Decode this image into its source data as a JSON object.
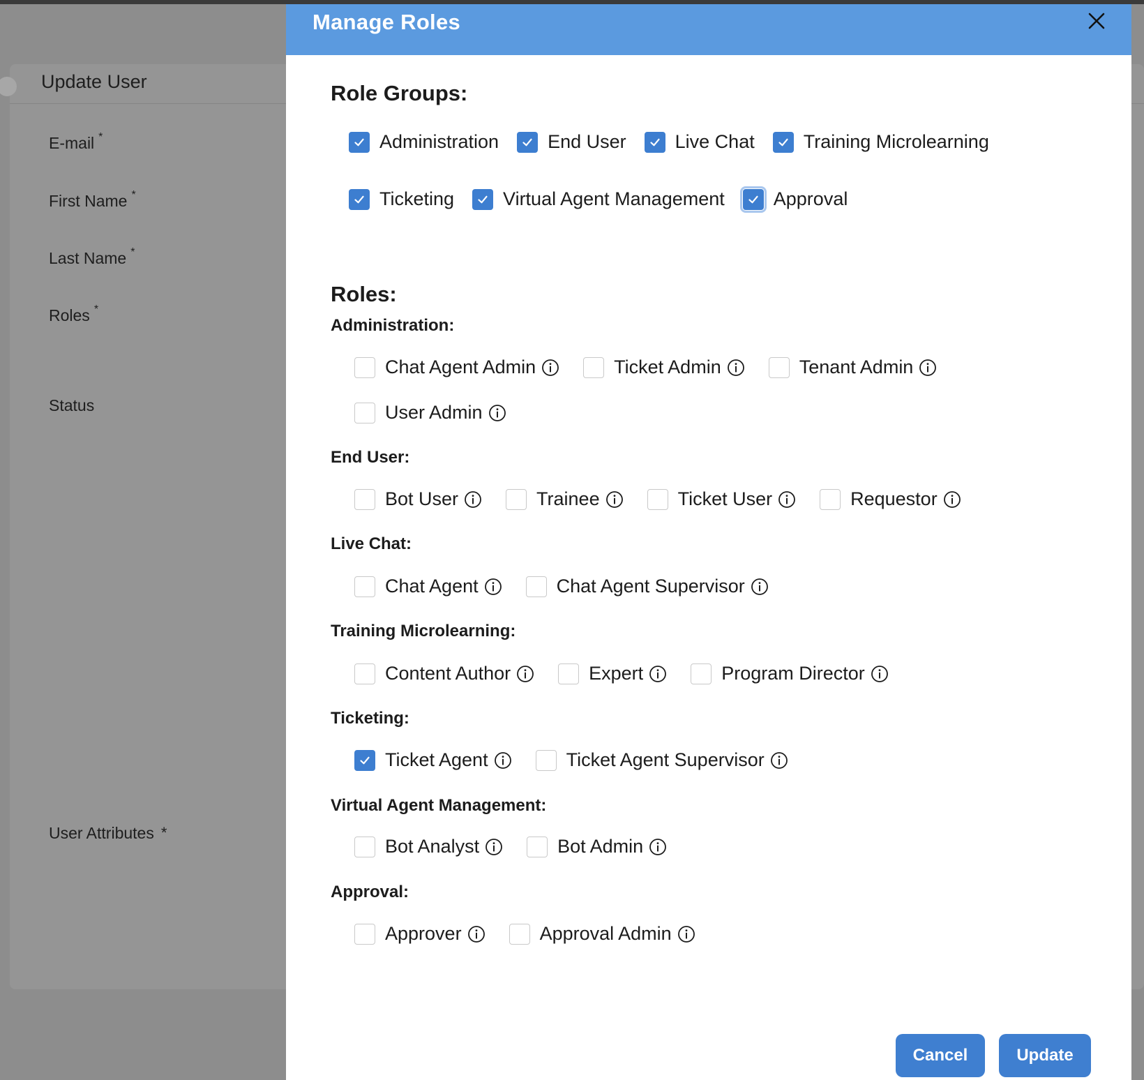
{
  "background": {
    "card_title": "Update User",
    "fields": [
      {
        "label": "E-mail",
        "required": "*"
      },
      {
        "label": "First Name",
        "required": "*"
      },
      {
        "label": "Last Name",
        "required": "*"
      },
      {
        "label": "Roles",
        "required": "*"
      },
      {
        "label": "Status",
        "required": ""
      },
      {
        "label": "User Attributes",
        "required": "*"
      }
    ]
  },
  "modal": {
    "title": "Manage Roles",
    "close_icon": "close-icon",
    "role_groups_heading": "Role Groups:",
    "role_groups": [
      {
        "label": "Administration",
        "checked": true
      },
      {
        "label": "End User",
        "checked": true
      },
      {
        "label": "Live Chat",
        "checked": true
      },
      {
        "label": "Training Microlearning",
        "checked": true
      },
      {
        "label": "Ticketing",
        "checked": true
      },
      {
        "label": "Virtual Agent Management",
        "checked": true
      },
      {
        "label": "Approval",
        "checked": true,
        "focused": true
      }
    ],
    "roles_heading": "Roles:",
    "role_sections": [
      {
        "title": "Administration:",
        "roles": [
          {
            "label": "Chat Agent Admin",
            "checked": false
          },
          {
            "label": "Ticket Admin",
            "checked": false
          },
          {
            "label": "Tenant Admin",
            "checked": false
          },
          {
            "label": "User Admin",
            "checked": false
          }
        ]
      },
      {
        "title": "End User:",
        "roles": [
          {
            "label": "Bot User",
            "checked": false
          },
          {
            "label": "Trainee",
            "checked": false
          },
          {
            "label": "Ticket User",
            "checked": false
          },
          {
            "label": "Requestor",
            "checked": false
          }
        ]
      },
      {
        "title": "Live Chat:",
        "roles": [
          {
            "label": "Chat Agent",
            "checked": false
          },
          {
            "label": "Chat Agent Supervisor",
            "checked": false
          }
        ]
      },
      {
        "title": "Training Microlearning:",
        "roles": [
          {
            "label": "Content Author",
            "checked": false
          },
          {
            "label": "Expert",
            "checked": false
          },
          {
            "label": "Program Director",
            "checked": false
          }
        ]
      },
      {
        "title": "Ticketing:",
        "roles": [
          {
            "label": "Ticket Agent",
            "checked": true
          },
          {
            "label": "Ticket Agent Supervisor",
            "checked": false
          }
        ]
      },
      {
        "title": "Virtual Agent Management:",
        "roles": [
          {
            "label": "Bot Analyst",
            "checked": false
          },
          {
            "label": "Bot Admin",
            "checked": false
          }
        ]
      },
      {
        "title": "Approval:",
        "roles": [
          {
            "label": "Approver",
            "checked": false
          },
          {
            "label": "Approval Admin",
            "checked": false
          }
        ]
      }
    ],
    "cancel_label": "Cancel",
    "update_label": "Update"
  },
  "colors": {
    "header": "#5b9adf",
    "checkbox_checked": "#3d7ed0",
    "button": "#3f7fd0",
    "overlay": "#8d8d8d"
  }
}
